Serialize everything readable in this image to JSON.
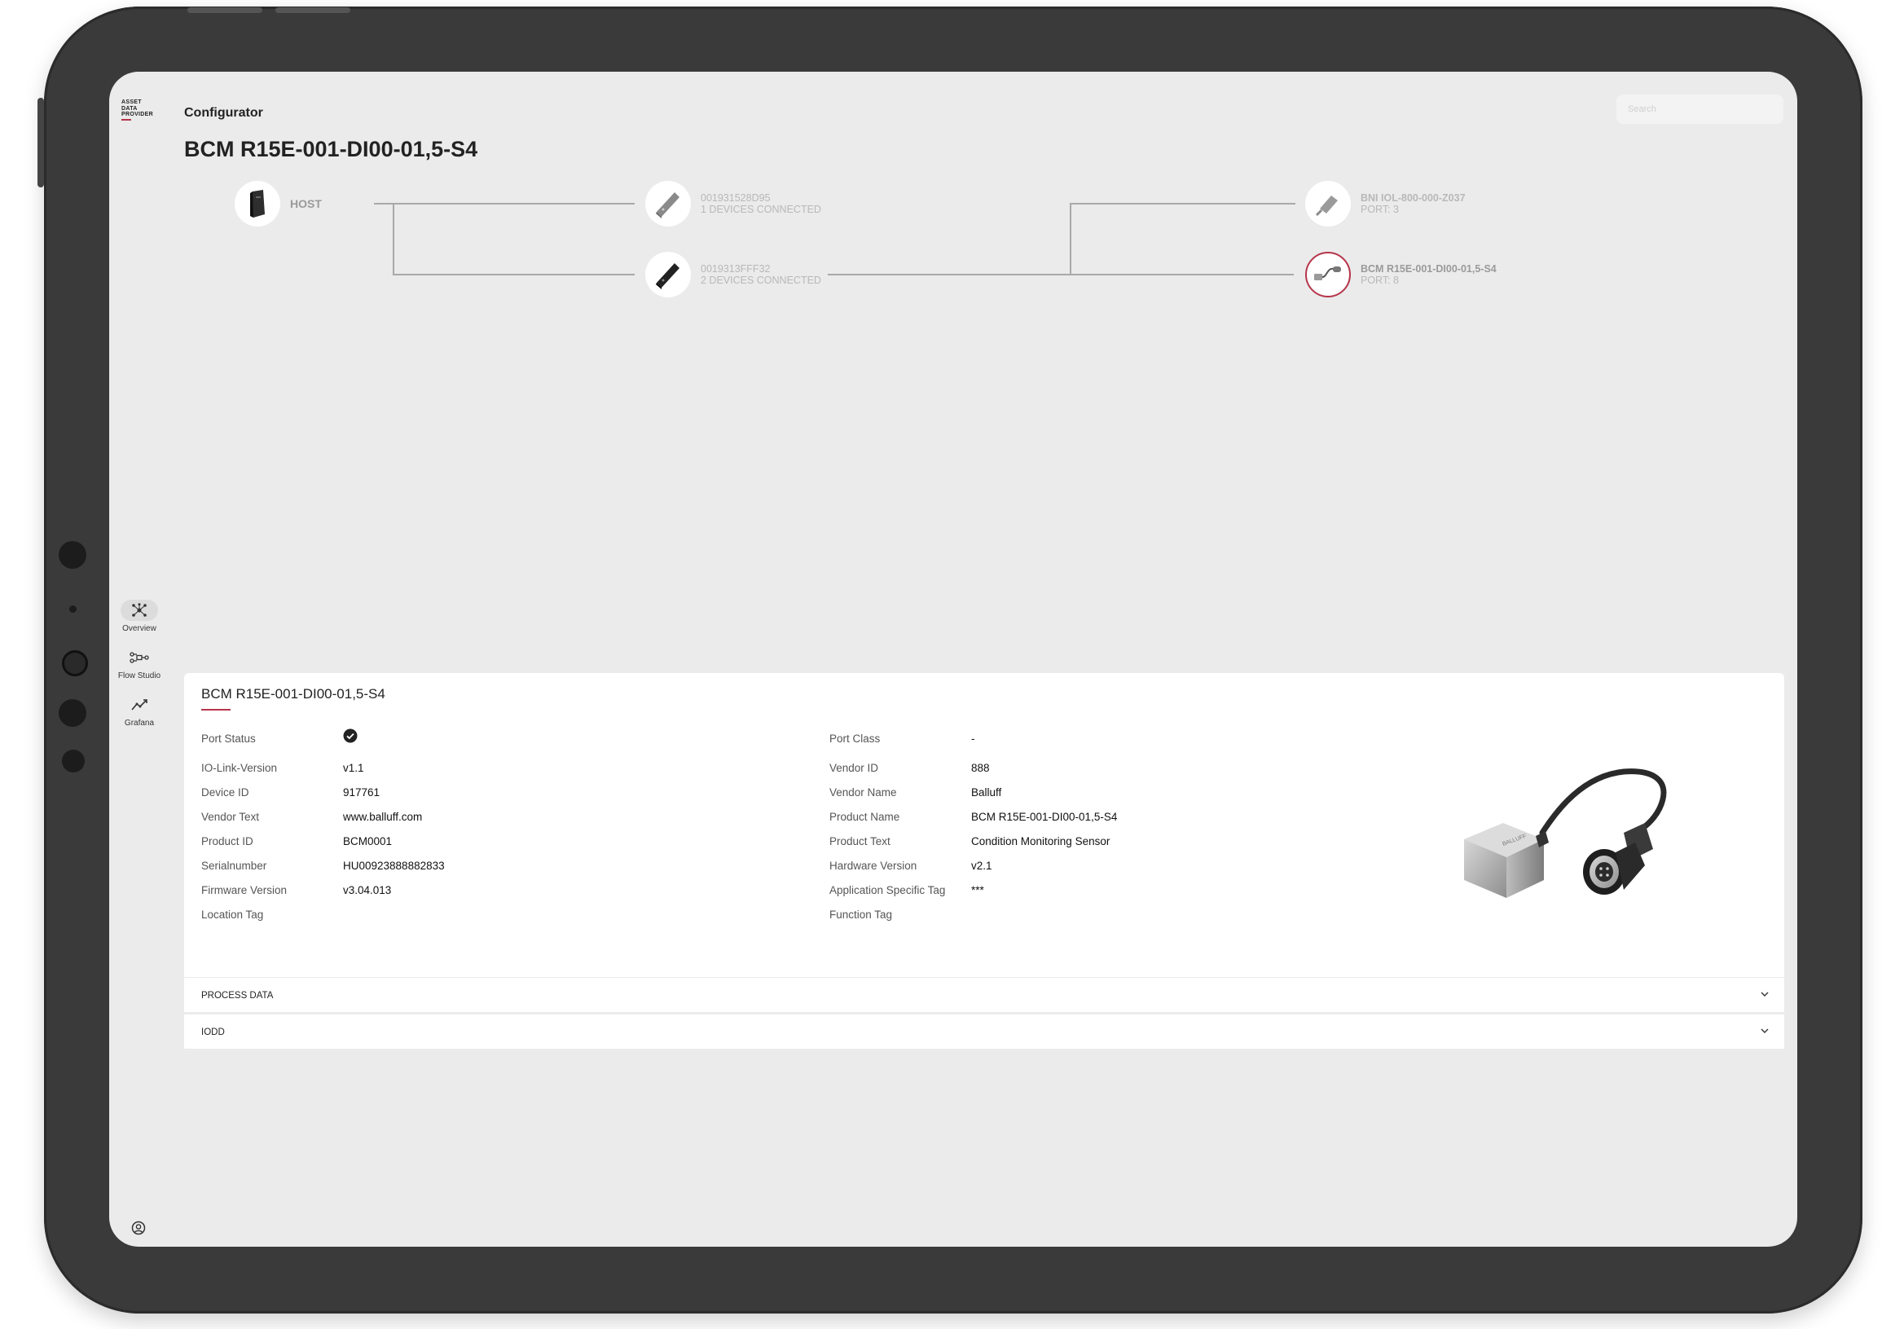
{
  "app": {
    "logo_lines": [
      "ASSET",
      "DATA",
      "PROVIDER"
    ],
    "breadcrumb": "Configurator",
    "page_title": "BCM R15E-001-DI00-01,5-S4",
    "search_placeholder": "Search"
  },
  "nav": [
    {
      "label": "Overview",
      "icon": "network-icon",
      "active": true
    },
    {
      "label": "Flow Studio",
      "icon": "flow-icon",
      "active": false
    },
    {
      "label": "Grafana",
      "icon": "chart-icon",
      "active": false
    }
  ],
  "topology": {
    "host": {
      "label": "HOST"
    },
    "masters": [
      {
        "name": "001931528D95",
        "sub": "1 DEVICES CONNECTED"
      },
      {
        "name": "0019313FFF32",
        "sub": "2 DEVICES CONNECTED"
      }
    ],
    "devices": [
      {
        "name": "BNI IOL-800-000-Z037",
        "sub": "PORT: 3"
      },
      {
        "name": "BCM R15E-001-DI00-01,5-S4",
        "sub": "PORT: 8"
      }
    ]
  },
  "details": {
    "title": "BCM R15E-001-DI00-01,5-S4",
    "left": [
      {
        "key": "Port Status",
        "value": "",
        "icon": "check-circle-icon"
      },
      {
        "key": "IO-Link-Version",
        "value": "v1.1"
      },
      {
        "key": "Device ID",
        "value": "917761"
      },
      {
        "key": "Vendor Text",
        "value": "www.balluff.com"
      },
      {
        "key": "Product ID",
        "value": "BCM0001"
      },
      {
        "key": "Serialnumber",
        "value": "HU00923888882833"
      },
      {
        "key": "Firmware Version",
        "value": "v3.04.013"
      },
      {
        "key": "Location Tag",
        "value": ""
      }
    ],
    "right": [
      {
        "key": "Port Class",
        "value": "-"
      },
      {
        "key": "Vendor ID",
        "value": "888"
      },
      {
        "key": "Vendor Name",
        "value": "Balluff"
      },
      {
        "key": "Product Name",
        "value": "BCM R15E-001-DI00-01,5-S4"
      },
      {
        "key": "Product Text",
        "value": "Condition Monitoring Sensor"
      },
      {
        "key": "Hardware Version",
        "value": "v2.1"
      },
      {
        "key": "Application Specific Tag",
        "value": "***"
      },
      {
        "key": "Function Tag",
        "value": ""
      }
    ],
    "product_image_text": "BALLUFF"
  },
  "accordions": [
    {
      "label": "PROCESS DATA"
    },
    {
      "label": "IODD"
    }
  ],
  "colors": {
    "accent": "#b5364b",
    "screen_bg": "#ebebeb",
    "bezel": "#3a3a3a"
  }
}
